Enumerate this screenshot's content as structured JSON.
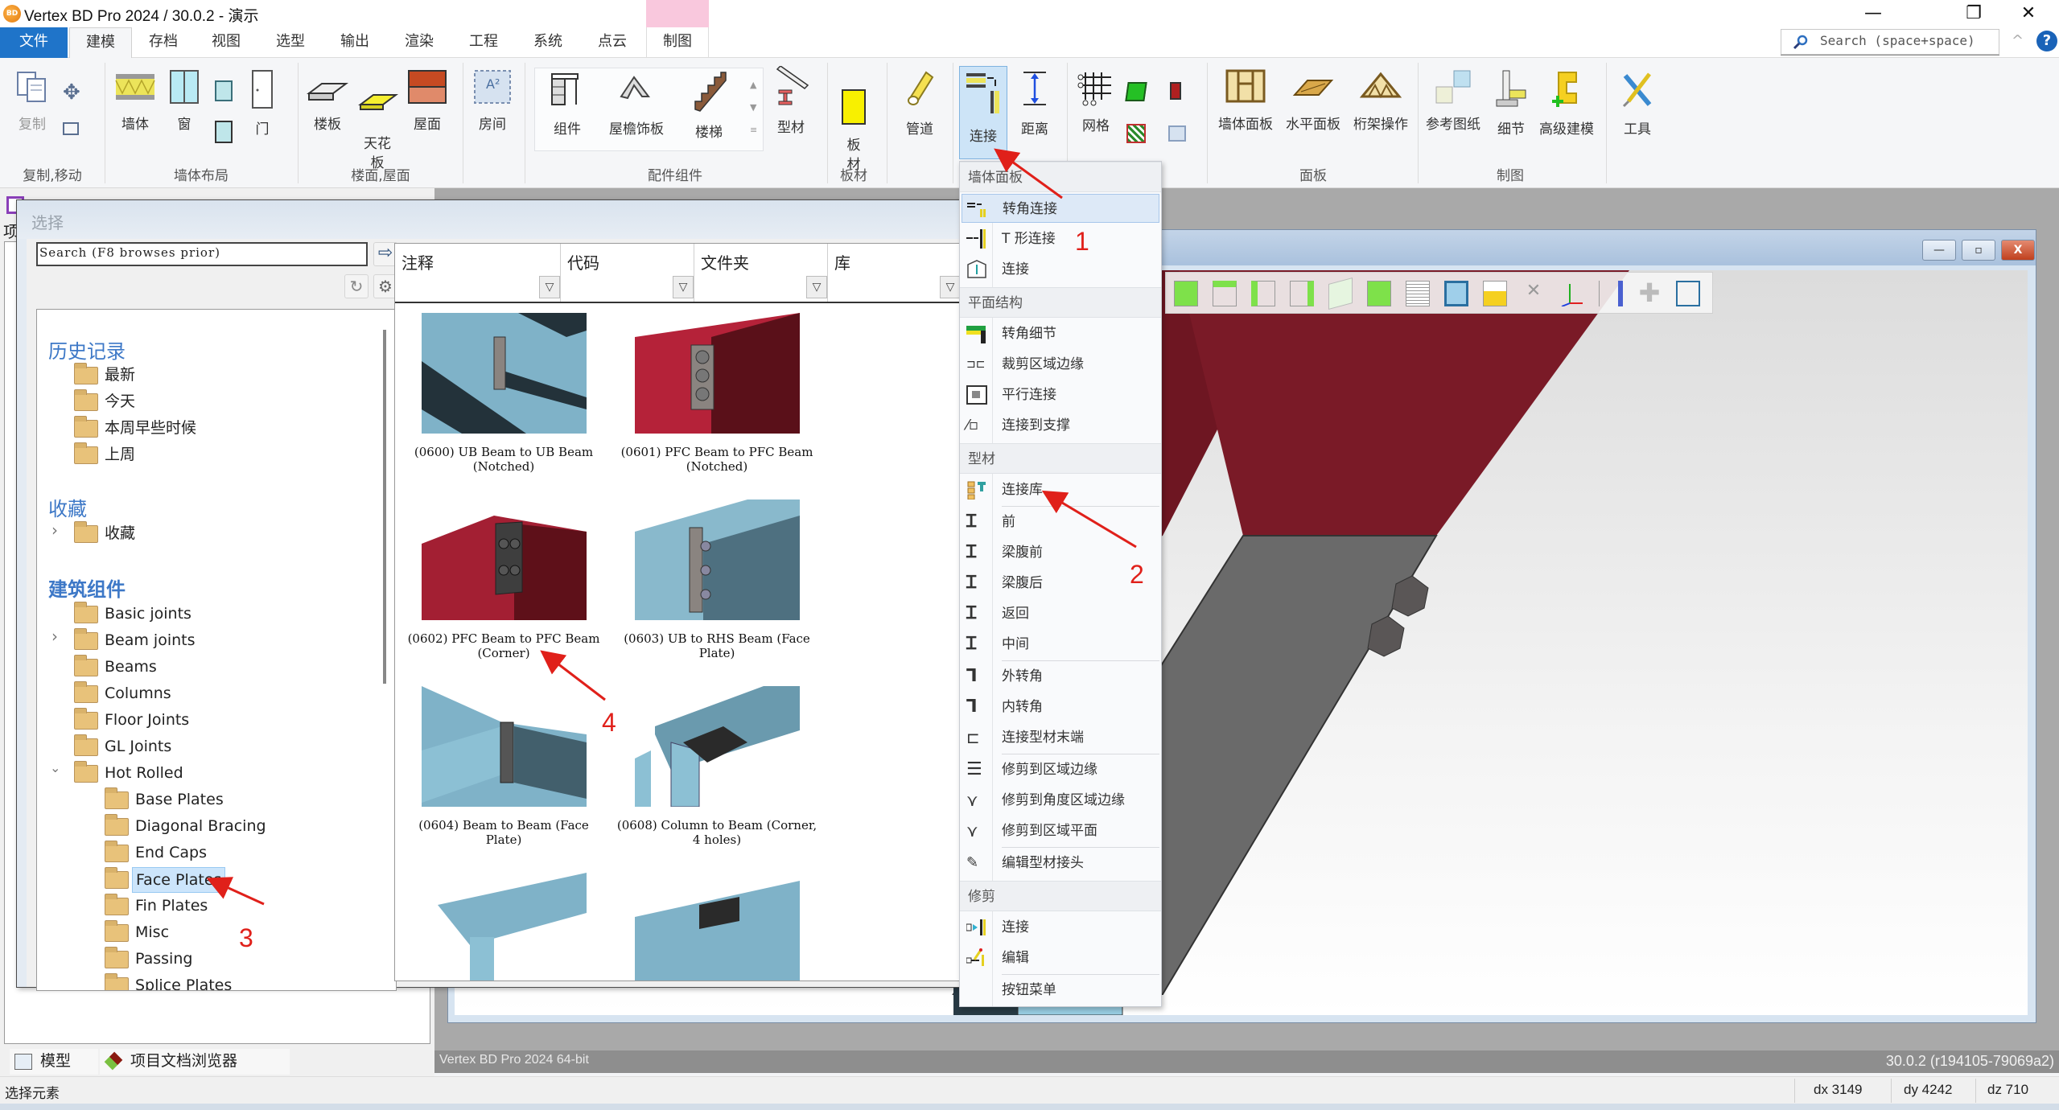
{
  "window": {
    "title": "Vertex BD Pro 2024 / 30.0.2 - 演示",
    "logo_text": "BD",
    "controls": {
      "minimize": "—",
      "restore": "❐",
      "close": "✕"
    }
  },
  "ribbon_tabs": [
    {
      "label": "文件",
      "state": "file"
    },
    {
      "label": "建模",
      "state": "active"
    },
    {
      "label": "存档"
    },
    {
      "label": "视图"
    },
    {
      "label": "选型"
    },
    {
      "label": "输出"
    },
    {
      "label": "渲染"
    },
    {
      "label": "工程"
    },
    {
      "label": "系统"
    },
    {
      "label": "点云"
    },
    {
      "label": "制图",
      "state": "context"
    }
  ],
  "search": {
    "placeholder": "Search (space+space)",
    "help": "?",
    "collapse": "^"
  },
  "ribbon_groups": [
    {
      "label": "复制,移动",
      "buttons": [
        "复制",
        "移动"
      ]
    },
    {
      "label": "墙体布局",
      "buttons": [
        "墙体",
        "窗",
        "门"
      ]
    },
    {
      "label": "楼面,屋面",
      "buttons": [
        "楼板",
        "天花板",
        "屋面"
      ]
    },
    {
      "label": "",
      "buttons": [
        "房间"
      ]
    },
    {
      "label": "配件组件",
      "buttons": [
        "组件",
        "屋檐饰板",
        "楼梯",
        "型材",
        "管道"
      ]
    },
    {
      "label": "板材",
      "buttons": [
        "板材"
      ]
    },
    {
      "label": "",
      "buttons": [
        "连接",
        "距离"
      ]
    },
    {
      "label": "",
      "buttons": [
        "网格"
      ]
    },
    {
      "label": "面板",
      "buttons": [
        "墙体面板",
        "水平面板",
        "桁架操作"
      ]
    },
    {
      "label": "制图",
      "buttons": [
        "参考图纸",
        "细节",
        "高级建模"
      ]
    },
    {
      "label": "",
      "buttons": [
        "工具"
      ]
    }
  ],
  "ribbon_buttons": {
    "copy": "复制",
    "wall": "墙体",
    "window": "窗",
    "door": "门",
    "floor": "楼板",
    "ceiling": "天花\n板",
    "roof": "屋面",
    "room": "房间",
    "component": "组件",
    "eave": "屋檐饰板",
    "stair": "楼梯",
    "profile": "型材",
    "board": "板\n材",
    "pipe": "管道",
    "connect": "连接",
    "distance": "距离",
    "grid": "网格",
    "wall_panel": "墙体面板",
    "horizontal_panel": "水平面板",
    "truss": "桁架操作",
    "ref_drawing": "参考图纸",
    "detail": "细节",
    "advanced": "高级建模",
    "tools": "工具"
  },
  "group_labels": {
    "copy_move": "复制,移动",
    "wall_layout": "墙体布局",
    "floor_roof": "楼面,屋面",
    "accessories": "配件组件",
    "boards": "板材",
    "panels": "面板",
    "drafting": "制图"
  },
  "select_dialog": {
    "title": "选择",
    "search_placeholder": "Search (F8 browses prior)",
    "tree": {
      "history_head": "历史记录",
      "history": [
        "最新",
        "今天",
        "本周早些时候",
        "上周"
      ],
      "favorites_head": "收藏",
      "favorites": [
        "收藏"
      ],
      "components_head": "建筑组件",
      "components": [
        "Basic joints",
        "Beam joints",
        "Beams",
        "Columns",
        "Floor Joints",
        "GL Joints",
        "Hot Rolled"
      ],
      "hot_rolled_children": [
        "Base Plates",
        "Diagonal Bracing",
        "End Caps",
        "Face Plates",
        "Fin Plates",
        "Misc",
        "Passing",
        "Splice Plates"
      ],
      "selected": "Face Plates"
    },
    "columns": [
      "注释",
      "代码",
      "文件夹",
      "库"
    ],
    "items": [
      {
        "code": "0600",
        "caption": "(0600) UB Beam to UB Beam (Notched)",
        "color": "blue"
      },
      {
        "code": "0601",
        "caption": "(0601) PFC Beam to PFC Beam (Notched)",
        "color": "red"
      },
      {
        "code": "0602",
        "caption": "(0602) PFC Beam to PFC Beam (Corner)",
        "color": "red"
      },
      {
        "code": "0603",
        "caption": "(0603) UB to RHS Beam (Face Plate)",
        "color": "blue"
      },
      {
        "code": "0604",
        "caption": "(0604) Beam to Beam (Face Plate)",
        "color": "blue"
      },
      {
        "code": "0608",
        "caption": "(0608) Column to Beam (Corner, 4 holes)",
        "color": "blue"
      }
    ]
  },
  "connection_menu": {
    "sections": [
      {
        "head": "墙体面板",
        "items": [
          "转角连接",
          "T 形连接",
          "连接"
        ]
      },
      {
        "head": "平面结构",
        "items": [
          "转角细节",
          "裁剪区域边缘",
          "平行连接",
          "连接到支撑"
        ]
      },
      {
        "head": "型材",
        "items": [
          "连接库",
          "前",
          "梁腹前",
          "梁腹后",
          "返回",
          "中间",
          "外转角",
          "内转角",
          "连接型材末端",
          "修剪到区域边缘",
          "修剪到角度区域边缘",
          "修剪到区域平面",
          "编辑型材接头"
        ]
      },
      {
        "head": "修剪",
        "items": [
          "连接",
          "编辑",
          "按钮菜单"
        ]
      }
    ],
    "highlighted": "转角连接"
  },
  "annotations": [
    "1",
    "2",
    "3",
    "4"
  ],
  "panel_tabs": [
    "模型",
    "项目文档浏览器"
  ],
  "project_panel_label": "项",
  "viewport": {
    "info_left": "Vertex BD Pro  2024  64-bit",
    "version": "30.0.2 (r194105-79069a2)",
    "win_buttons": [
      "—",
      "▫",
      "X"
    ]
  },
  "status": {
    "message": "选择元素",
    "dx": "dx 3149",
    "dy": "dy 4242",
    "dz": "dz 710"
  },
  "colors": {
    "accent": "#1f74c9",
    "context_tab": "#f9c8dd",
    "annotation": "#e0201a",
    "beam_red": "#8b1a2b",
    "beam_blue": "#8cb7cc",
    "selection": "#cce5fb"
  }
}
